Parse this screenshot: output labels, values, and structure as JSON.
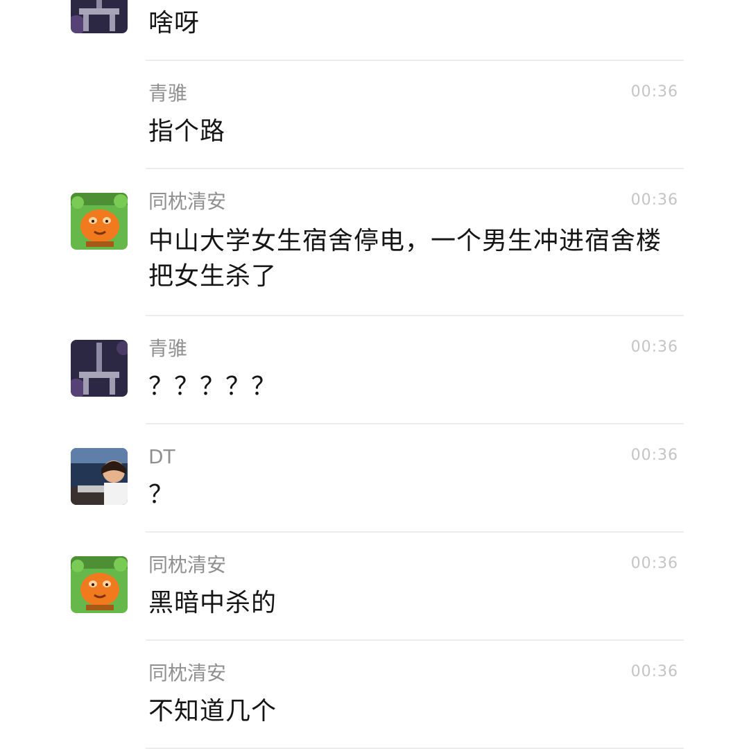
{
  "messages": [
    {
      "sender": "",
      "time": "",
      "text": "啥呀",
      "avatar": "tower-avatar"
    },
    {
      "sender": "青骓",
      "time": "00:36",
      "text": "指个路",
      "avatar": ""
    },
    {
      "sender": "同枕清安",
      "time": "00:36",
      "text": "中山大学女生宿舍停电，一个男生冲进宿舍楼把女生杀了",
      "avatar": "cartoon-avatar"
    },
    {
      "sender": "青骓",
      "time": "00:36",
      "text": "？？？？？",
      "avatar": "tower-avatar"
    },
    {
      "sender": "DT",
      "time": "00:36",
      "text": "？",
      "avatar": "girl-photo-avatar"
    },
    {
      "sender": "同枕清安",
      "time": "00:36",
      "text": "黑暗中杀的",
      "avatar": "cartoon-avatar"
    },
    {
      "sender": "同枕清安",
      "time": "00:36",
      "text": "不知道几个",
      "avatar": ""
    }
  ],
  "colors": {
    "sender": "#8f8f8f",
    "time": "#c4c4c4",
    "text": "#151515",
    "divider": "#ececec",
    "background": "#ffffff"
  }
}
